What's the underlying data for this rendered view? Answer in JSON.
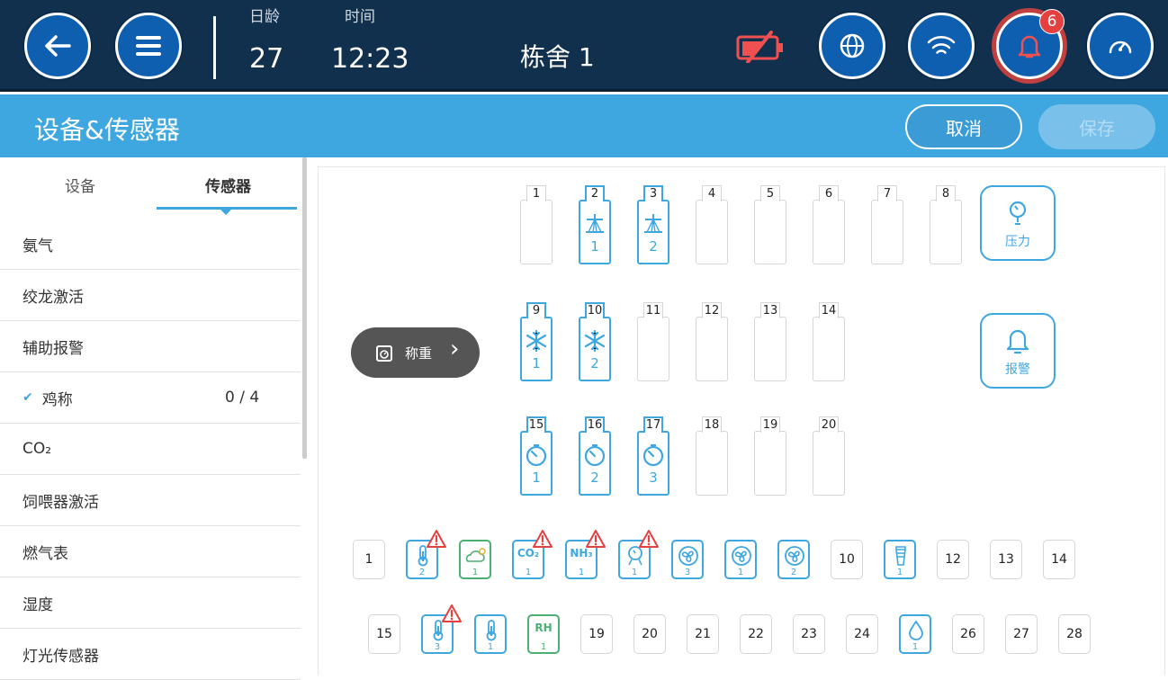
{
  "topbar": {
    "age_label": "日龄",
    "age_value": "27",
    "time_label": "时间",
    "time_value": "12:23",
    "house": "栋舍 1",
    "alarm_count": "6"
  },
  "header": {
    "title": "设备&传感器",
    "cancel": "取消",
    "save": "保存"
  },
  "sidebar": {
    "tabs": [
      "设备",
      "传感器"
    ],
    "items": [
      {
        "label": "氨气",
        "count": ""
      },
      {
        "label": "绞龙激活",
        "count": ""
      },
      {
        "label": "辅助报警",
        "count": ""
      },
      {
        "label": "鸡称",
        "count": "0 / 4",
        "checked": true
      },
      {
        "label": "CO₂",
        "count": ""
      },
      {
        "label": "饲喂器激活",
        "count": ""
      },
      {
        "label": "燃气表",
        "count": ""
      },
      {
        "label": "湿度",
        "count": ""
      },
      {
        "label": "灯光传感器",
        "count": ""
      }
    ],
    "check_glyph": "✔"
  },
  "slots": {
    "row1": [
      {
        "n": "1"
      },
      {
        "n": "2",
        "icon": "sprinkler-icon",
        "sub": "1"
      },
      {
        "n": "3",
        "icon": "sprinkler-icon",
        "sub": "2"
      },
      {
        "n": "4"
      },
      {
        "n": "5"
      },
      {
        "n": "6"
      },
      {
        "n": "7"
      },
      {
        "n": "8"
      }
    ],
    "row2": [
      {
        "n": "9",
        "icon": "snowflake-icon",
        "sub": "1"
      },
      {
        "n": "10",
        "icon": "snowflake-icon",
        "sub": "2"
      },
      {
        "n": "11"
      },
      {
        "n": "12"
      },
      {
        "n": "13"
      },
      {
        "n": "14"
      }
    ],
    "row3": [
      {
        "n": "15",
        "icon": "timer-icon",
        "sub": "1"
      },
      {
        "n": "16",
        "icon": "timer-icon",
        "sub": "2"
      },
      {
        "n": "17",
        "icon": "timer-icon",
        "sub": "3"
      },
      {
        "n": "18"
      },
      {
        "n": "19"
      },
      {
        "n": "20"
      }
    ]
  },
  "weigh_button": {
    "label": "称重",
    "arrow": "›"
  },
  "pressure_button": {
    "label": "压力"
  },
  "alarm_button": {
    "label": "报警"
  },
  "analog": {
    "row1": [
      {
        "n": "1"
      },
      {
        "icon": "thermometer-icon",
        "sub": "2",
        "style": "blue",
        "warn": true
      },
      {
        "icon": "weather-icon",
        "sub": "1",
        "style": "green"
      },
      {
        "text": "CO₂",
        "sub": "1",
        "style": "blue",
        "warn": true
      },
      {
        "text": "NH₃",
        "sub": "1",
        "style": "blue",
        "warn": true
      },
      {
        "icon": "pressure-sensor-icon",
        "sub": "1",
        "style": "blue",
        "warn": true
      },
      {
        "icon": "fan-icon",
        "sub": "3",
        "style": "blue"
      },
      {
        "icon": "fan-icon",
        "sub": "1",
        "style": "blue"
      },
      {
        "icon": "fan-icon",
        "sub": "2",
        "style": "blue"
      },
      {
        "n": "10"
      },
      {
        "icon": "silo-icon",
        "sub": "1",
        "style": "blue"
      },
      {
        "n": "12"
      },
      {
        "n": "13"
      },
      {
        "n": "14"
      }
    ],
    "row2": [
      {
        "n": "15"
      },
      {
        "icon": "thermometer-icon",
        "sub": "3",
        "style": "blue",
        "warn": true
      },
      {
        "icon": "thermometer-icon",
        "sub": "1",
        "style": "blue"
      },
      {
        "text": "RH",
        "sub": "1",
        "style": "green"
      },
      {
        "n": "19"
      },
      {
        "n": "20"
      },
      {
        "n": "21"
      },
      {
        "n": "22"
      },
      {
        "n": "23"
      },
      {
        "n": "24"
      },
      {
        "icon": "water-drop-icon",
        "sub": "1",
        "style": "blue"
      },
      {
        "n": "26"
      },
      {
        "n": "27"
      },
      {
        "n": "28"
      }
    ]
  },
  "colors": {
    "navy": "#11304e",
    "accent": "#3fa7e0",
    "green": "#4caf73",
    "alert": "#e54040"
  }
}
